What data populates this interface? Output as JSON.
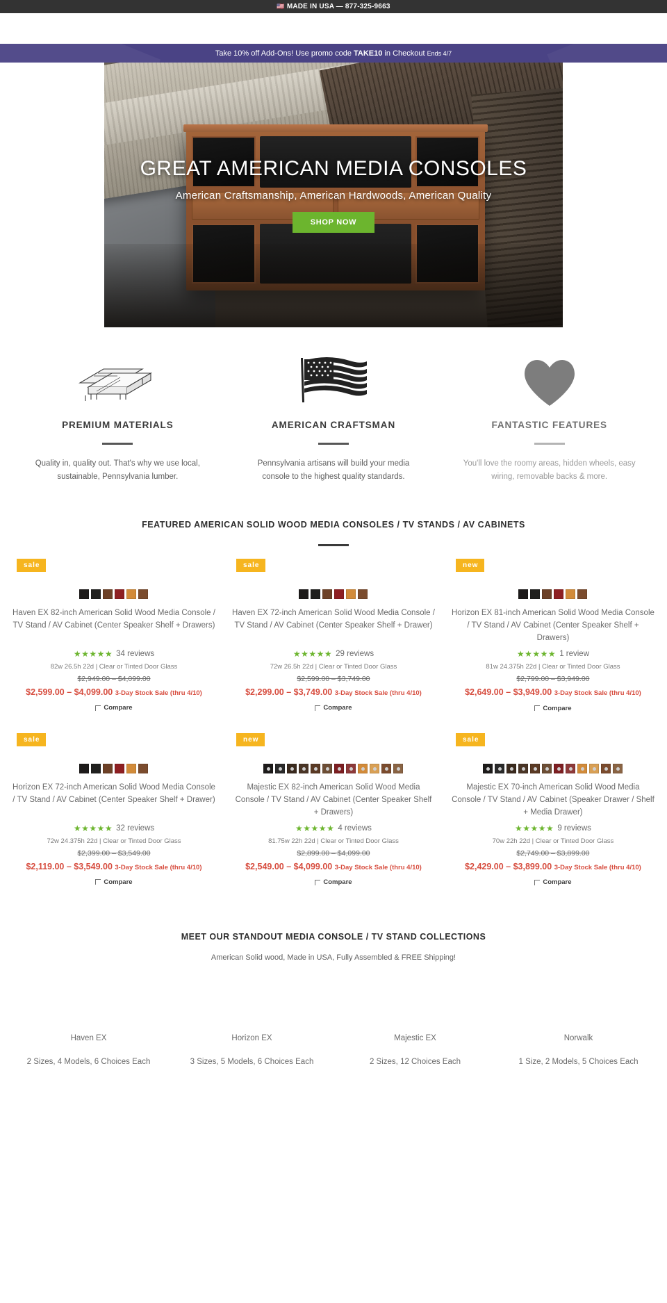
{
  "announcement": {
    "flag_icon": "us-flag-icon",
    "text": "MADE IN USA — 877-325-9663"
  },
  "promo": {
    "lead": "Take 10% off Add-Ons! Use promo code ",
    "code": "TAKE10",
    "mid": " in Checkout ",
    "ends": "Ends 4/7",
    "bg_color": "#4a4385"
  },
  "hero": {
    "title": "GREAT AMERICAN MEDIA CONSOLES",
    "subtitle": "American Craftsmanship, American Hardwoods, American Quality",
    "button_label": "SHOP NOW",
    "button_color": "#6cb52e"
  },
  "features": [
    {
      "icon": "lumber-stack-icon",
      "title": "PREMIUM MATERIALS",
      "desc": "Quality in, quality out. That's why we use local, sustainable, Pennsylvania lumber."
    },
    {
      "icon": "american-flag-icon",
      "title": "AMERICAN CRAFTSMAN",
      "desc": "Pennsylvania artisans will build your media console to the highest quality standards."
    },
    {
      "icon": "heart-icon",
      "title": "FANTASTIC FEATURES",
      "desc": "You'll love the roomy areas, hidden wheels, easy wiring, removable backs & more."
    }
  ],
  "featured": {
    "heading": "FEATURED AMERICAN SOLID WOOD MEDIA CONSOLES / TV STANDS / AV CABINETS",
    "compare_label": "Compare",
    "badge_colors": {
      "sale": "#f6b51f",
      "new": "#f6b51f"
    },
    "sale_price_color": "#d74d3f",
    "star_color": "#6cb52e",
    "products": [
      {
        "badge": "sale",
        "swatches": [
          "#1d1b1a",
          "#20201e",
          "#6d4127",
          "#8e1f22",
          "#d28b3a",
          "#7b4c2e"
        ],
        "swatch_style": "plain",
        "title": "Haven EX 82-inch American Solid Wood Media Console / TV Stand / AV Cabinet (Center Speaker Shelf + Drawers)",
        "stars": "★★★★★",
        "reviews": "34 reviews",
        "dims": "82w 26.5h 22d | Clear or Tinted Door Glass",
        "was": "$2,949.00 – $4,099.00",
        "now": "$2,599.00 – $4,099.00",
        "sale_note": "3-Day Stock Sale (thru 4/10)"
      },
      {
        "badge": "sale",
        "swatches": [
          "#1d1b1a",
          "#20201e",
          "#6d4127",
          "#8e1f22",
          "#d28b3a",
          "#7b4c2e"
        ],
        "swatch_style": "plain",
        "title": "Haven EX 72-inch American Solid Wood Media Console / TV Stand / AV Cabinet (Center Speaker Shelf + Drawer)",
        "stars": "★★★★★",
        "reviews": "29 reviews",
        "dims": "72w 26.5h 22d | Clear or Tinted Door Glass",
        "was": "$2,599.00 – $3,749.00",
        "now": "$2,299.00 – $3,749.00",
        "sale_note": "3-Day Stock Sale (thru 4/10)"
      },
      {
        "badge": "new",
        "swatches": [
          "#1d1b1a",
          "#20201e",
          "#6d4127",
          "#8e1f22",
          "#d28b3a",
          "#7b4c2e"
        ],
        "swatch_style": "plain",
        "title": "Horizon EX 81-inch American Solid Wood Media Console / TV Stand / AV Cabinet (Center Speaker Shelf + Drawers)",
        "stars": "★★★★★",
        "reviews": "1 review",
        "dims": "81w 24.375h 22d | Clear or Tinted Door Glass",
        "was": "$2,799.00 – $3,949.00",
        "now": "$2,649.00 – $3,949.00",
        "sale_note": "3-Day Stock Sale (thru 4/10)"
      },
      {
        "badge": "sale",
        "swatches": [
          "#1d1b1a",
          "#20201e",
          "#6d4127",
          "#8e1f22",
          "#d28b3a",
          "#7b4c2e"
        ],
        "swatch_style": "plain",
        "title": "Horizon EX 72-inch American Solid Wood Media Console / TV Stand / AV Cabinet (Center Speaker Shelf + Drawer)",
        "stars": "★★★★★",
        "reviews": "32 reviews",
        "dims": "72w 24.375h 22d | Clear or Tinted Door Glass",
        "was": "$2,399.00 – $3,549.00",
        "now": "$2,119.00 – $3,549.00",
        "sale_note": "3-Day Stock Sale (thru 4/10)"
      },
      {
        "badge": "new",
        "swatches": [
          "#1d1b1a",
          "#2a2a2a",
          "#3a2a1e",
          "#4a3526",
          "#5a3a24",
          "#6d4e35",
          "#7d1f22",
          "#8e3a3a",
          "#d28b3a",
          "#d9a055",
          "#7b4c2e",
          "#8a6444"
        ],
        "swatch_style": "dot",
        "title": "Majestic EX 82-inch American Solid Wood Media Console / TV Stand / AV Cabinet (Center Speaker Shelf + Drawers)",
        "stars": "★★★★★",
        "reviews": "4 reviews",
        "dims": "81.75w 22h 22d | Clear or Tinted Door Glass",
        "was": "$2,899.00 – $4,099.00",
        "now": "$2,549.00 – $4,099.00",
        "sale_note": "3-Day Stock Sale (thru 4/10)"
      },
      {
        "badge": "sale",
        "swatches": [
          "#1d1b1a",
          "#2a2a2a",
          "#3a2a1e",
          "#4a3526",
          "#5a3a24",
          "#6d4e35",
          "#7d1f22",
          "#8e3a3a",
          "#d28b3a",
          "#d9a055",
          "#7b4c2e",
          "#8a6444"
        ],
        "swatch_style": "dot",
        "title": "Majestic EX 70-inch American Solid Wood Media Console / TV Stand / AV Cabinet (Speaker Drawer / Shelf + Media Drawer)",
        "stars": "★★★★★",
        "reviews": "9 reviews",
        "dims": "70w 22h 22d | Clear or Tinted Door Glass",
        "was": "$2,749.00 – $3,899.00",
        "now": "$2,429.00 – $3,899.00",
        "sale_note": "3-Day Stock Sale (thru 4/10)"
      }
    ]
  },
  "collections": {
    "heading": "MEET OUR STANDOUT MEDIA CONSOLE / TV STAND COLLECTIONS",
    "subheading": "American Solid wood, Made in USA, Fully Assembled & FREE Shipping!",
    "items": [
      {
        "name": "Haven EX",
        "desc": "2 Sizes, 4 Models, 6 Choices Each"
      },
      {
        "name": "Horizon EX",
        "desc": "3 Sizes, 5 Models, 6 Choices Each"
      },
      {
        "name": "Majestic EX",
        "desc": "2 Sizes, 12 Choices Each"
      },
      {
        "name": "Norwalk",
        "desc": "1 Size, 2 Models, 5 Choices Each"
      }
    ]
  }
}
